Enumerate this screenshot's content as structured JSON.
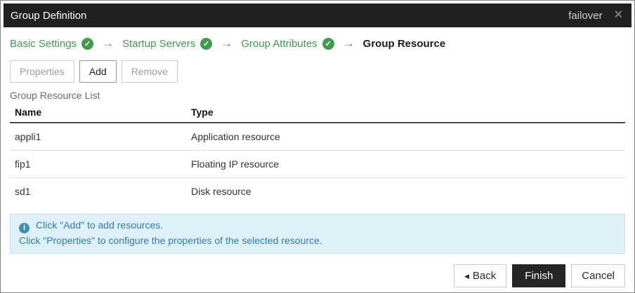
{
  "titlebar": {
    "title": "Group Definition",
    "context": "failover"
  },
  "icons": {
    "close": "✕",
    "check": "✓",
    "arrow": "→",
    "back_triangle": "◀",
    "info": "i"
  },
  "wizard": {
    "steps": [
      {
        "label": "Basic Settings",
        "completed": true
      },
      {
        "label": "Startup Servers",
        "completed": true
      },
      {
        "label": "Group Attributes",
        "completed": true
      },
      {
        "label": "Group Resource",
        "completed": false,
        "current": true
      }
    ]
  },
  "toolbar": {
    "properties_label": "Properties",
    "add_label": "Add",
    "remove_label": "Remove"
  },
  "list": {
    "caption": "Group Resource List",
    "columns": [
      "Name",
      "Type"
    ],
    "rows": [
      {
        "name": "appli1",
        "type": "Application resource"
      },
      {
        "name": "fip1",
        "type": "Floating IP resource"
      },
      {
        "name": "sd1",
        "type": "Disk resource"
      }
    ]
  },
  "info": {
    "line1": "Click \"Add\" to add resources.",
    "line2": "Click \"Properties\" to configure the properties of the selected resource."
  },
  "footer": {
    "back_label": "Back",
    "finish_label": "Finish",
    "cancel_label": "Cancel"
  },
  "colors": {
    "titlebar_bg": "#212121",
    "accent_green": "#3f9b4c",
    "info_text": "#2f7cab",
    "info_bg": "#def0f8",
    "info_icon_bg": "#3a8fb7"
  }
}
